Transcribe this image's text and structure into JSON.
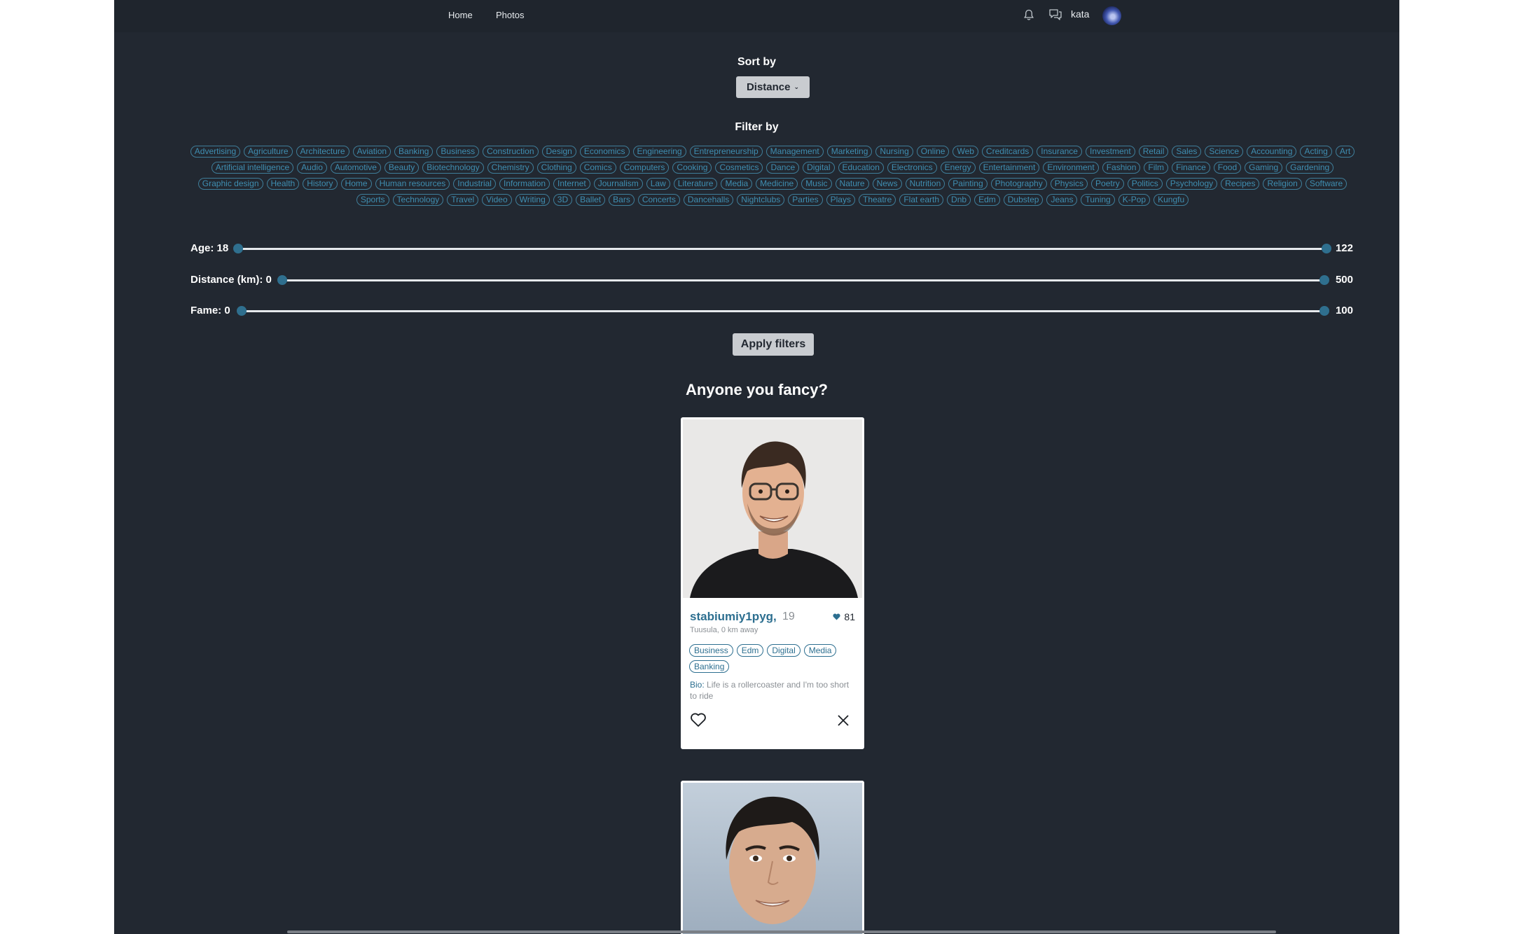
{
  "nav": {
    "links": [
      "Home",
      "Photos"
    ],
    "username": "kata"
  },
  "sort": {
    "title": "Sort by",
    "selected": "Distance"
  },
  "filter": {
    "title": "Filter by",
    "tags": [
      "Advertising",
      "Agriculture",
      "Architecture",
      "Aviation",
      "Banking",
      "Business",
      "Construction",
      "Design",
      "Economics",
      "Engineering",
      "Entrepreneurship",
      "Management",
      "Marketing",
      "Nursing",
      "Online",
      "Web",
      "Creditcards",
      "Insurance",
      "Investment",
      "Retail",
      "Sales",
      "Science",
      "Accounting",
      "Acting",
      "Art",
      "Artificial intelligence",
      "Audio",
      "Automotive",
      "Beauty",
      "Biotechnology",
      "Chemistry",
      "Clothing",
      "Comics",
      "Computers",
      "Cooking",
      "Cosmetics",
      "Dance",
      "Digital",
      "Education",
      "Electronics",
      "Energy",
      "Entertainment",
      "Environment",
      "Fashion",
      "Film",
      "Finance",
      "Food",
      "Gaming",
      "Gardening",
      "Graphic design",
      "Health",
      "History",
      "Home",
      "Human resources",
      "Industrial",
      "Information",
      "Internet",
      "Journalism",
      "Law",
      "Literature",
      "Media",
      "Medicine",
      "Music",
      "Nature",
      "News",
      "Nutrition",
      "Painting",
      "Photography",
      "Physics",
      "Poetry",
      "Politics",
      "Psychology",
      "Recipes",
      "Religion",
      "Software",
      "Sports",
      "Technology",
      "Travel",
      "Video",
      "Writing",
      "3D",
      "Ballet",
      "Bars",
      "Concerts",
      "Dancehalls",
      "Nightclubs",
      "Parties",
      "Plays",
      "Theatre",
      "Flat earth",
      "Dnb",
      "Edm",
      "Dubstep",
      "Jeans",
      "Tuning",
      "K-Pop",
      "Kungfu"
    ]
  },
  "sliders": {
    "age": {
      "label": "Age: 18",
      "min": 18,
      "max": 122,
      "max_label": "122",
      "low": 18,
      "high": 122
    },
    "distance": {
      "label": "Distance (km): 0",
      "min": 0,
      "max": 500,
      "max_label": "500",
      "low": 0,
      "high": 500
    },
    "fame": {
      "label": "Fame: 0",
      "min": 0,
      "max": 100,
      "max_label": "100",
      "low": 0,
      "high": 100
    }
  },
  "apply_label": "Apply filters",
  "headline": "Anyone you fancy?",
  "profile": {
    "name": "stabiumiy1pyg,",
    "age": "19",
    "fame": "81",
    "location": "Tuusula, 0 km away",
    "tags": [
      "Business",
      "Edm",
      "Digital",
      "Media",
      "Banking"
    ],
    "bio_label": "Bio:",
    "bio": "Life is a rollercoaster and I'm too short to ride"
  },
  "colors": {
    "background": "#222831",
    "accent": "#2d6f90",
    "tag": "#3f8eb1"
  }
}
